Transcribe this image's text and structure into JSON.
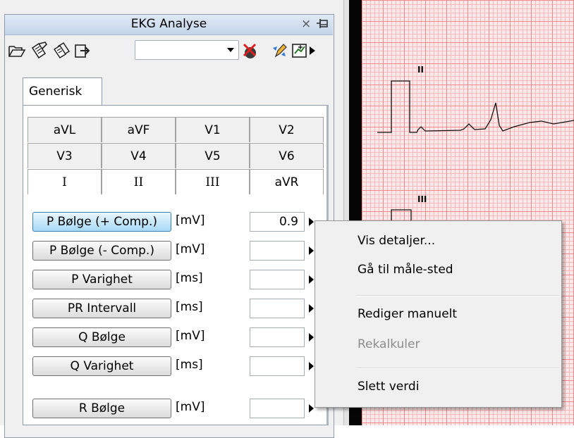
{
  "panel": {
    "title": "EKG Analyse",
    "close_glyph": "×",
    "toolbar": {
      "icons": [
        "open-folder-icon",
        "edit-sheet-icon",
        "edit-multi-icon",
        "export-icon",
        "delete-x-icon",
        "recalc-pencil-icon",
        "chart-icon",
        "more-arrow-icon"
      ],
      "dropdown_value": ""
    },
    "tab_generisk": "Generisk",
    "lead_tabs": {
      "row1": [
        "aVL",
        "aVF",
        "V1",
        "V2"
      ],
      "row2": [
        "V3",
        "V4",
        "V5",
        "V6"
      ],
      "row3": [
        "I",
        "II",
        "III",
        "aVR"
      ]
    },
    "measurements": [
      {
        "label": "P Bølge (+ Comp.)",
        "unit": "[mV]",
        "value": "0.9"
      },
      {
        "label": "P Bølge (- Comp.)",
        "unit": "[mV]",
        "value": ""
      },
      {
        "label": "P Varighet",
        "unit": "[ms]",
        "value": ""
      },
      {
        "label": "PR Intervall",
        "unit": "[ms]",
        "value": ""
      },
      {
        "label": "Q Bølge",
        "unit": "[mV]",
        "value": ""
      },
      {
        "label": "Q Varighet",
        "unit": "[ms]",
        "value": ""
      },
      {
        "label": "R Bølge",
        "unit": "[mV]",
        "value": ""
      }
    ]
  },
  "ecg": {
    "lead_labels": [
      "II",
      "III"
    ],
    "grid_major_color": "#f08a8a",
    "grid_minor_color": "#f7b9b9"
  },
  "context_menu": {
    "items": [
      {
        "label": "Vis detaljer...",
        "enabled": true
      },
      {
        "label": "Gå til måle-sted",
        "enabled": true
      },
      {
        "label": "Rediger manuelt",
        "enabled": true
      },
      {
        "label": "Rekalkuler",
        "enabled": false
      },
      {
        "label": "Slett verdi",
        "enabled": true
      }
    ]
  }
}
